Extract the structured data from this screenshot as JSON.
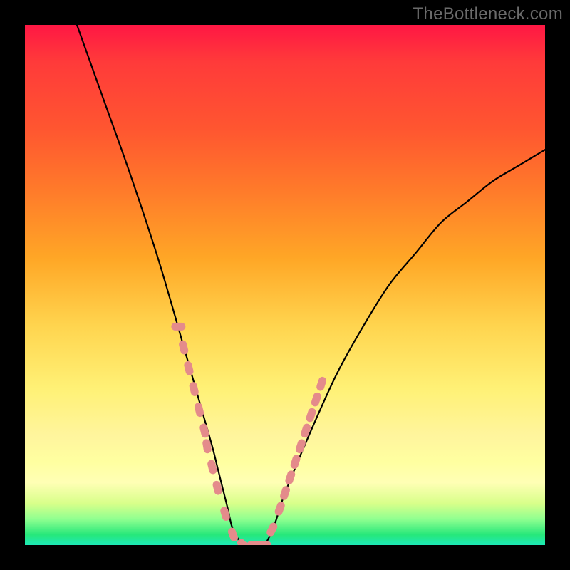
{
  "watermark": "TheBottleneck.com",
  "colors": {
    "curve_stroke": "#000000",
    "marker_fill": "#e48b8b",
    "background": "#000000"
  },
  "chart_data": {
    "type": "line",
    "title": "",
    "xlabel": "",
    "ylabel": "",
    "xlim": [
      0,
      100
    ],
    "ylim": [
      0,
      100
    ],
    "grid": false,
    "legend": false,
    "series": [
      {
        "name": "bottleneck-curve",
        "x": [
          10,
          15,
          20,
          25,
          28,
          30,
          32,
          34,
          36,
          37,
          38,
          39,
          40,
          42,
          44,
          46,
          48,
          50,
          55,
          60,
          65,
          70,
          75,
          80,
          85,
          90,
          95,
          100
        ],
        "y": [
          100,
          86,
          72,
          57,
          47,
          40,
          33,
          26,
          19,
          15,
          11,
          7,
          3,
          0,
          0,
          0,
          4,
          10,
          22,
          33,
          42,
          50,
          56,
          62,
          66,
          70,
          73,
          76
        ]
      }
    ],
    "markers": {
      "name": "highlight-band",
      "x": [
        29.5,
        30.5,
        31.5,
        32.5,
        33.5,
        34.5,
        35,
        36,
        37,
        38.5,
        40,
        42,
        44,
        46,
        47.5,
        49,
        50,
        51,
        52,
        53,
        54,
        55,
        56,
        57
      ],
      "y": [
        42,
        38,
        34,
        30,
        26,
        22,
        19,
        15,
        11,
        6,
        2,
        0,
        0,
        0,
        3,
        7,
        10,
        13,
        16,
        19,
        22,
        25,
        28,
        31
      ]
    }
  }
}
